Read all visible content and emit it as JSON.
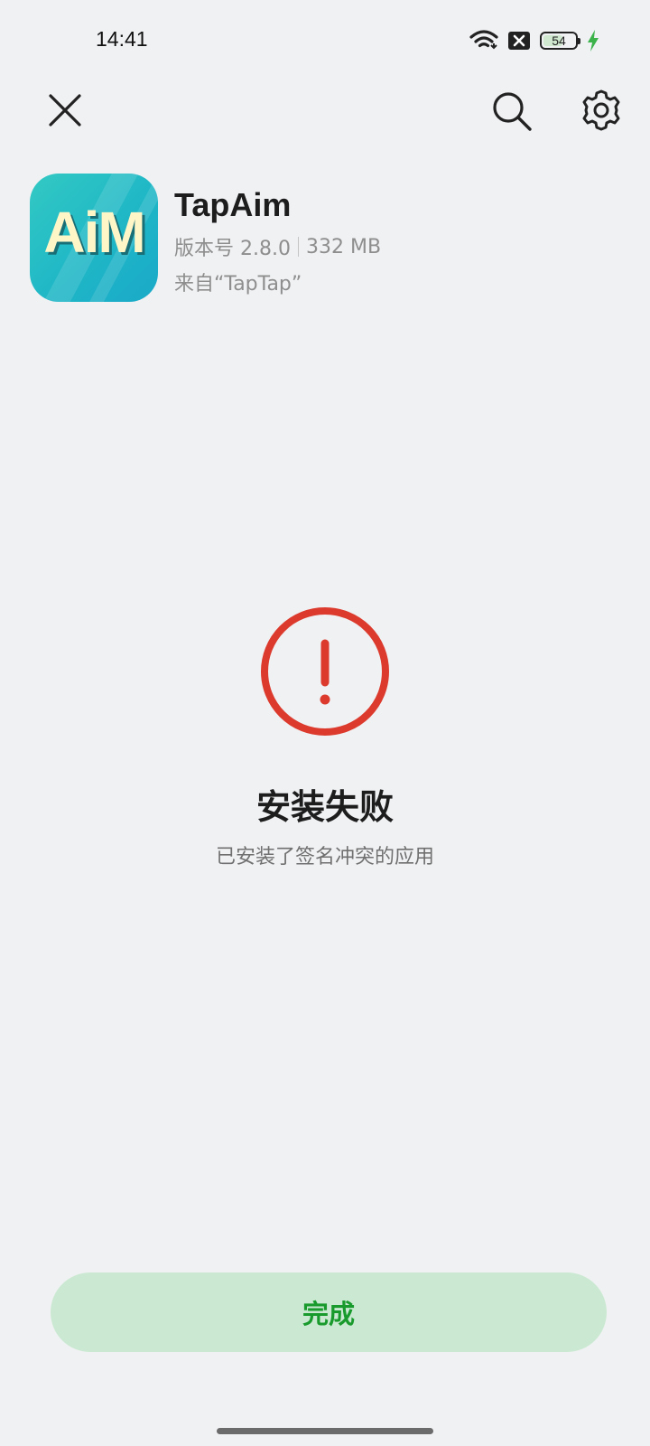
{
  "status_bar": {
    "time": "14:41",
    "battery_level": "54",
    "icons": [
      "wifi-icon",
      "sim-no-signal-icon",
      "battery-icon",
      "charging-bolt-icon"
    ]
  },
  "toolbar": {
    "close_icon": "close-icon",
    "search_icon": "search-icon",
    "settings_icon": "gear-icon"
  },
  "app": {
    "name": "TapAim",
    "icon_text": "AiM",
    "version": "版本号 2.8.0",
    "size": "332 MB",
    "source": "来自“TapTap”"
  },
  "result": {
    "icon": "error-exclamation-icon",
    "title": "安装失败",
    "message": "已安装了签名冲突的应用"
  },
  "actions": {
    "done_label": "完成"
  },
  "colors": {
    "background": "#f0f1f3",
    "error_red": "#dc3a2c",
    "done_button_bg": "#cbe9d2",
    "done_button_text": "#199a2c",
    "charging_green": "#3bb34a"
  }
}
